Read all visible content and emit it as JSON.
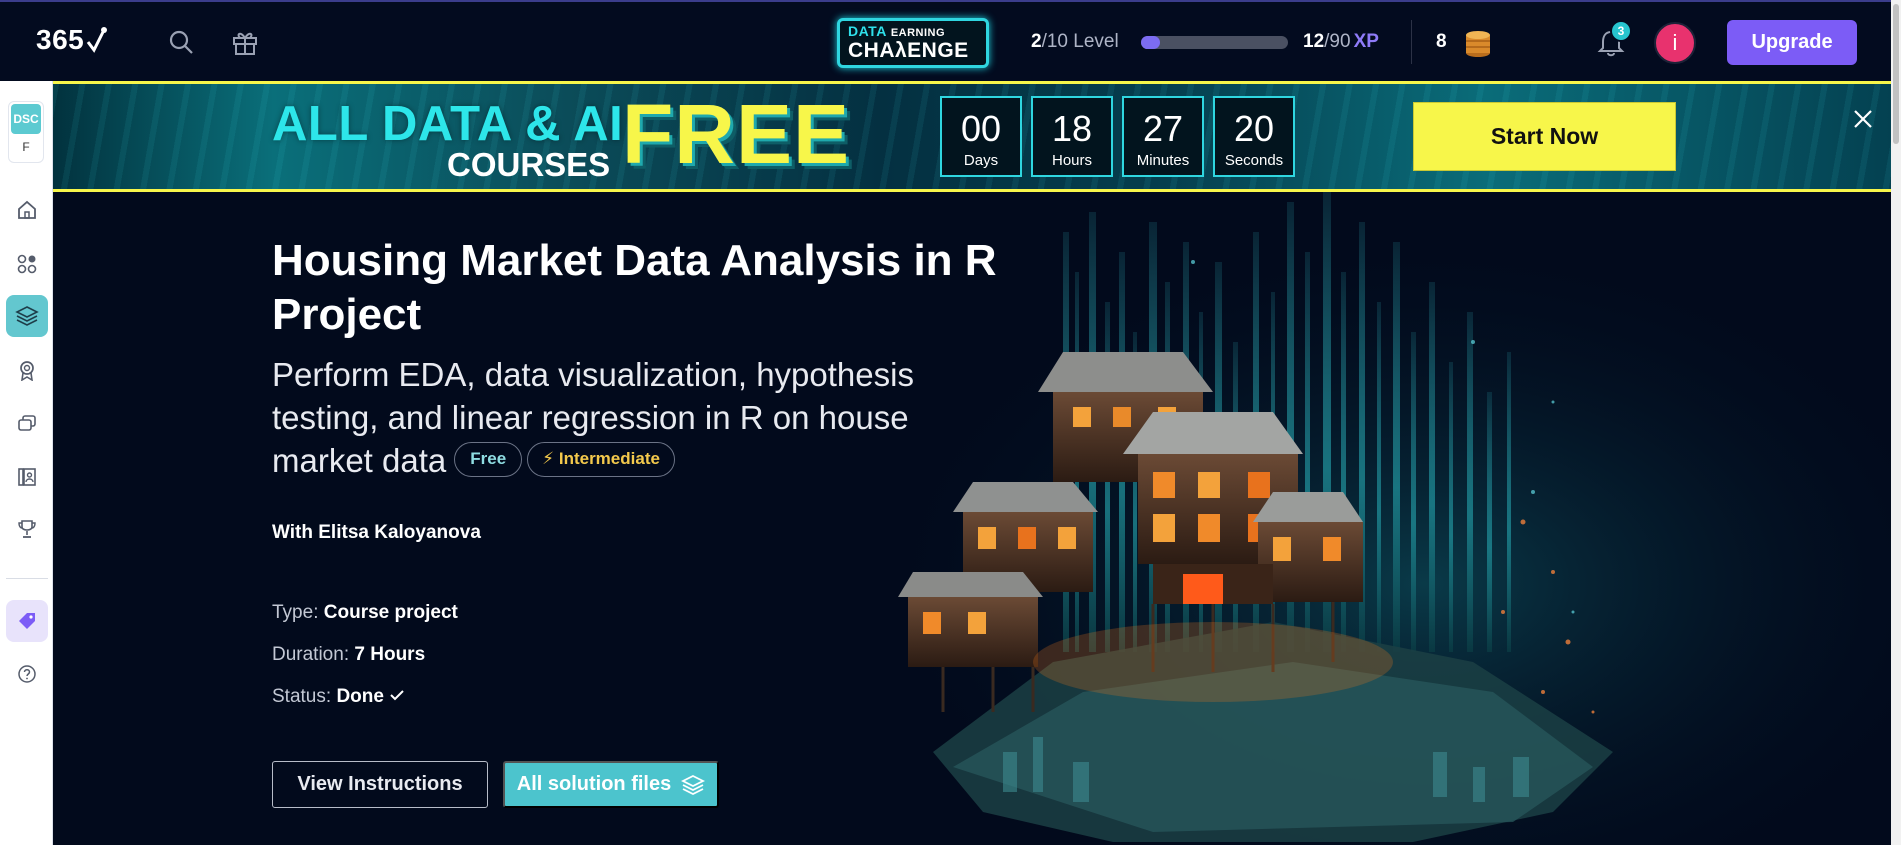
{
  "header": {
    "logo_text": "365",
    "challenge_line1": "DATA",
    "challenge_line1b": "EARNING",
    "challenge_line2": "CHAλENGE",
    "level_current": "2",
    "level_suffix": "/10 Level",
    "level_progress": 0.13,
    "xp_current": "12",
    "xp_suffix": "/90",
    "xp_label": "XP",
    "coins": "8",
    "notifications": "3",
    "avatar_letter": "i",
    "upgrade_label": "Upgrade"
  },
  "sidebar": {
    "workspace_tag": "DSC",
    "workspace_letter": "F"
  },
  "promo": {
    "title_line1": "ALL DATA & AI",
    "title_line2": "COURSES",
    "free": "FREE",
    "countdown": [
      {
        "value": "00",
        "label": "Days"
      },
      {
        "value": "18",
        "label": "Hours"
      },
      {
        "value": "27",
        "label": "Minutes"
      },
      {
        "value": "20",
        "label": "Seconds"
      }
    ],
    "cta": "Start Now"
  },
  "hero": {
    "title": "Housing Market Data Analysis in R Project",
    "subtitle": "Perform EDA, data visualization, hypothesis testing, and linear regression in R on house market data",
    "pill_free": "Free",
    "pill_level": "Intermediate",
    "author": "With Elitsa Kaloyanova",
    "type_label": "Type:",
    "type_value": "Course project",
    "duration_label": "Duration:",
    "duration_value": "7 Hours",
    "status_label": "Status:",
    "status_value": "Done",
    "btn_instructions": "View Instructions",
    "btn_solutions": "All solution files"
  },
  "colors": {
    "accent_purple": "#7c5cf6",
    "accent_teal": "#4cc4cd",
    "promo_yellow": "#f7f64a",
    "background": "#030b1f"
  }
}
